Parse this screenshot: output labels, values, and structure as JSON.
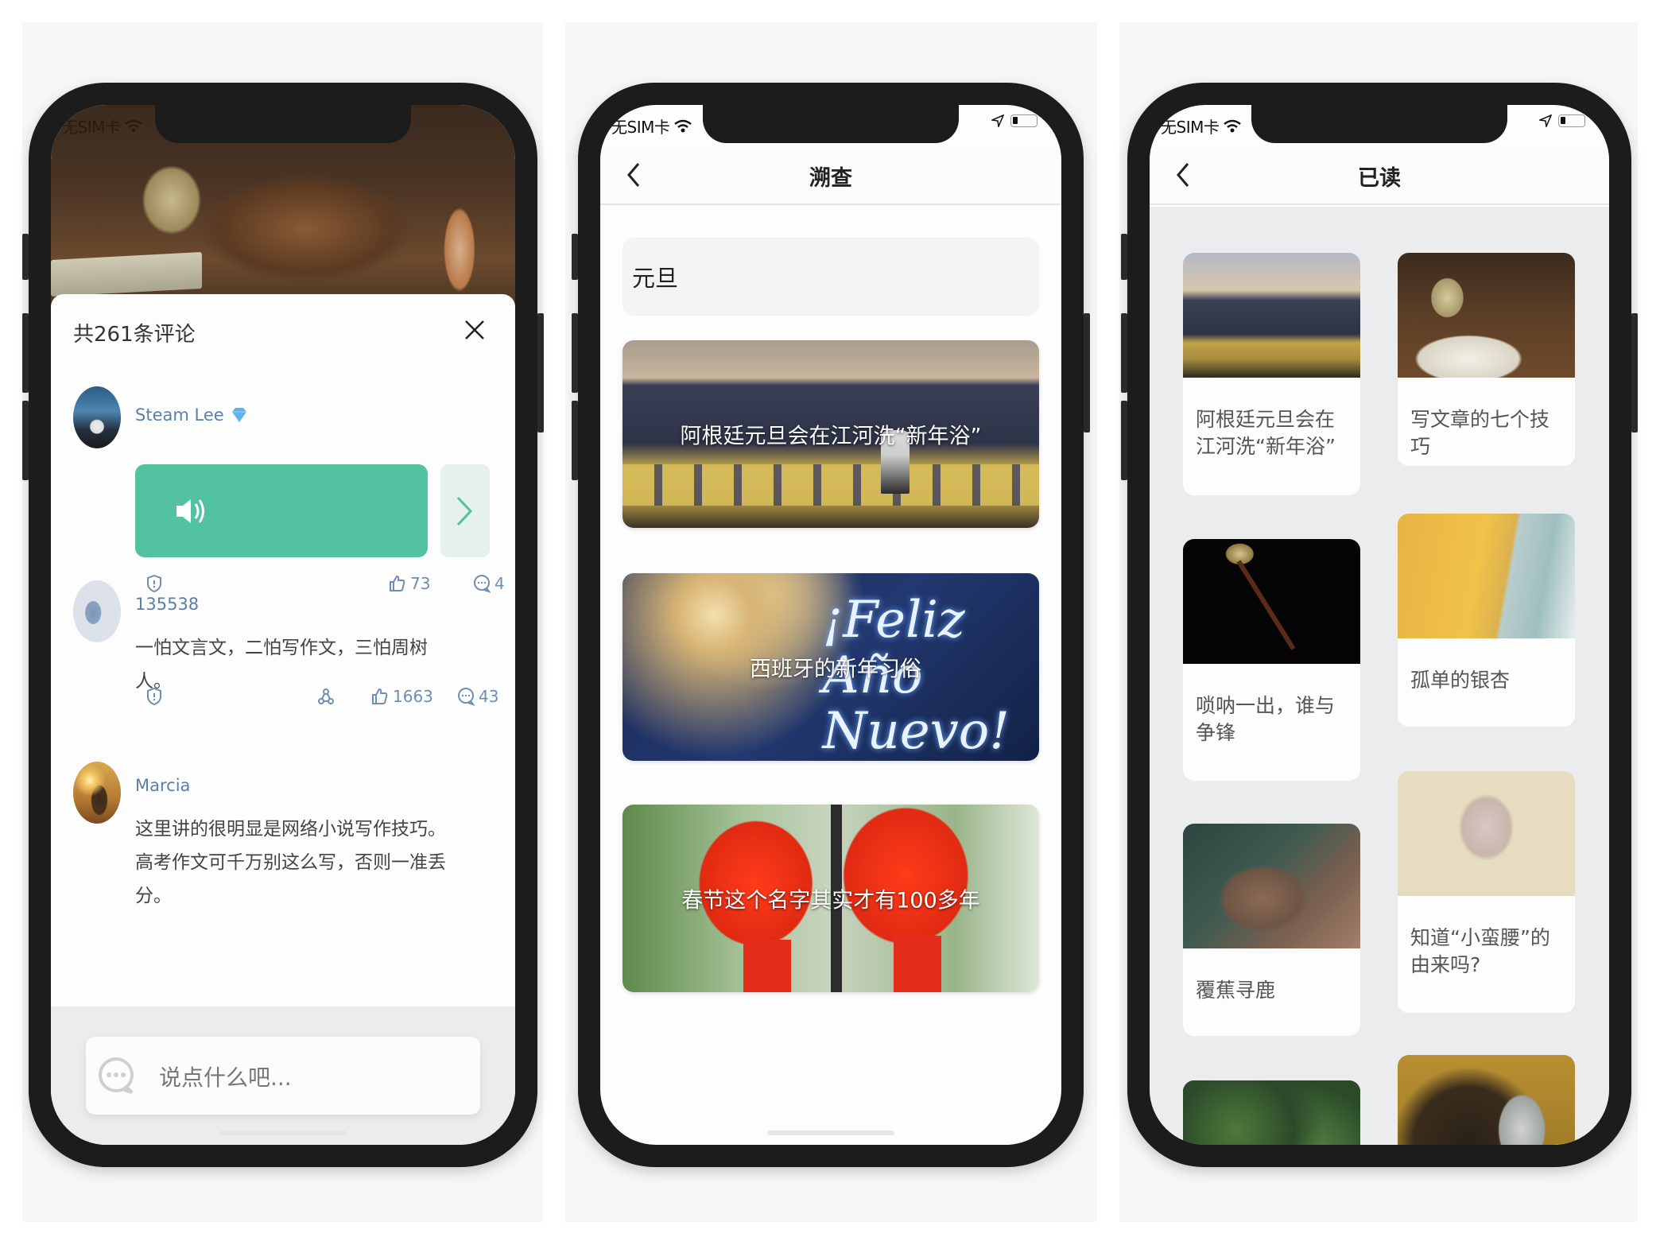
{
  "phones": [
    {
      "id": "comments",
      "status_bar": {
        "carrier": "无SIM卡"
      },
      "sheet": {
        "title": "共261条评论",
        "close_icon": "close-icon"
      },
      "comments": [
        {
          "user": "Steam Lee",
          "badge_icon": "diamond-icon",
          "type": "voice",
          "voice_icon": "speaker-icon",
          "next_icon": "chevron-right-icon",
          "likes": "73",
          "replies": "4",
          "has_share": false
        },
        {
          "user": "135538",
          "type": "text",
          "text": "一怕文言文，二怕写作文，三怕周树人。",
          "likes": "1663",
          "replies": "43",
          "has_share": true
        },
        {
          "user": "Marcia",
          "type": "text",
          "text": "这里讲的很明显是网络小说写作技巧。高考作文可千万别这么写，否则一准丢分。"
        }
      ],
      "input": {
        "placeholder": "说点什么吧..."
      },
      "colors": {
        "voice": "#52c2a0",
        "link": "#5b7fa6"
      }
    },
    {
      "id": "search",
      "status_bar": {
        "carrier": "无SIM卡"
      },
      "nav": {
        "title": "溯查",
        "back_icon": "chevron-left-icon"
      },
      "search": {
        "value": "元旦"
      },
      "results": [
        {
          "title": "阿根廷元旦会在江河洗“新年浴”",
          "image": "sea-promenade"
        },
        {
          "title": "西班牙的新年习俗",
          "image": "fireworks",
          "overlay": "¡Feliz Año Nuevo!"
        },
        {
          "title": "春节这个名字其实才有100多年",
          "image": "red-lanterns"
        }
      ]
    },
    {
      "id": "read",
      "status_bar": {
        "carrier": "无SIM卡"
      },
      "nav": {
        "title": "已读",
        "back_icon": "chevron-left-icon"
      },
      "left_column": [
        {
          "title": "阿根廷元旦会在江河洗“新年浴”",
          "image": "sea"
        },
        {
          "title": "唢呐一出，谁与争锋",
          "image": "suona"
        },
        {
          "title": "覆蕉寻鹿",
          "image": "deer"
        },
        {
          "title": "",
          "image": "forest"
        }
      ],
      "right_column": [
        {
          "title": "写文章的七个技巧",
          "image": "desk"
        },
        {
          "title": "孤单的银杏",
          "image": "ginkgo"
        },
        {
          "title": "知道“小蛮腰”的由来吗?",
          "image": "painting"
        },
        {
          "title": "",
          "image": "happy"
        }
      ]
    }
  ]
}
